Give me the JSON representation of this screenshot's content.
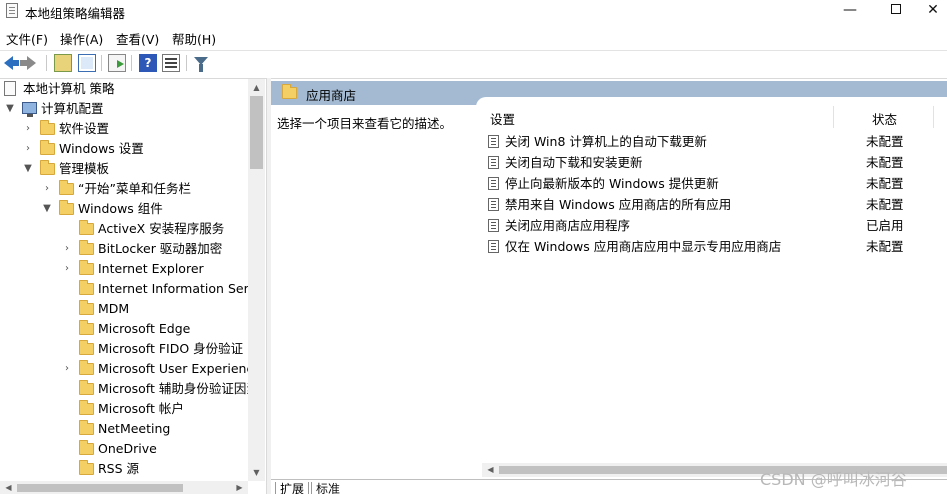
{
  "window": {
    "title": "本地组策略编辑器",
    "minimize": "—",
    "close": "✕"
  },
  "menu": [
    {
      "label": "文件(F)"
    },
    {
      "label": "操作(A)"
    },
    {
      "label": "查看(V)"
    },
    {
      "label": "帮助(H)"
    }
  ],
  "toolbar": {
    "icons": [
      "back-arrow-icon",
      "forward-arrow-icon",
      "up-folder-icon",
      "show-hide-tree-icon",
      "export-list-icon",
      "help-icon",
      "properties-icon",
      "filter-icon"
    ],
    "help_glyph": "?"
  },
  "tree": {
    "items": [
      {
        "label": "本地计算机 策略",
        "level": 0,
        "icon": "document-icon",
        "expander": ""
      },
      {
        "label": "计算机配置",
        "level": 1,
        "icon": "computer-icon",
        "expander": "▼"
      },
      {
        "label": "软件设置",
        "level": 2,
        "icon": "folder-icon",
        "expander": "›"
      },
      {
        "label": "Windows 设置",
        "level": 2,
        "icon": "folder-icon",
        "expander": "›"
      },
      {
        "label": "管理模板",
        "level": 2,
        "icon": "folder-icon",
        "expander": "▼"
      },
      {
        "label": "“开始”菜单和任务栏",
        "level": 3,
        "icon": "folder-icon",
        "expander": "›"
      },
      {
        "label": "Windows 组件",
        "level": 3,
        "icon": "folder-icon",
        "expander": "▼"
      },
      {
        "label": "ActiveX 安装程序服务",
        "level": 4,
        "icon": "folder-icon",
        "expander": ""
      },
      {
        "label": "BitLocker 驱动器加密",
        "level": 4,
        "icon": "folder-icon",
        "expander": "›"
      },
      {
        "label": "Internet Explorer",
        "level": 4,
        "icon": "folder-icon",
        "expander": "›"
      },
      {
        "label": "Internet Information Servi",
        "level": 4,
        "icon": "folder-icon",
        "expander": ""
      },
      {
        "label": "MDM",
        "level": 4,
        "icon": "folder-icon",
        "expander": ""
      },
      {
        "label": "Microsoft Edge",
        "level": 4,
        "icon": "folder-icon",
        "expander": ""
      },
      {
        "label": "Microsoft FIDO 身份验证",
        "level": 4,
        "icon": "folder-icon",
        "expander": ""
      },
      {
        "label": "Microsoft User Experience",
        "level": 4,
        "icon": "folder-icon",
        "expander": "›"
      },
      {
        "label": "Microsoft 辅助身份验证因素",
        "level": 4,
        "icon": "folder-icon",
        "expander": ""
      },
      {
        "label": "Microsoft 帐户",
        "level": 4,
        "icon": "folder-icon",
        "expander": ""
      },
      {
        "label": "NetMeeting",
        "level": 4,
        "icon": "folder-icon",
        "expander": ""
      },
      {
        "label": "OneDrive",
        "level": 4,
        "icon": "folder-icon",
        "expander": ""
      },
      {
        "label": "RSS 源",
        "level": 4,
        "icon": "folder-icon",
        "expander": ""
      }
    ]
  },
  "right": {
    "header_title": "应用商店",
    "description": "选择一个项目来查看它的描述。",
    "columns": {
      "setting": "设置",
      "state": "状态"
    },
    "rows": [
      {
        "name": "关闭 Win8 计算机上的自动下载更新",
        "state": "未配置"
      },
      {
        "name": "关闭自动下载和安装更新",
        "state": "未配置"
      },
      {
        "name": "停止向最新版本的 Windows 提供更新",
        "state": "未配置"
      },
      {
        "name": "禁用来自 Windows 应用商店的所有应用",
        "state": "未配置"
      },
      {
        "name": "关闭应用商店应用程序",
        "state": "已启用"
      },
      {
        "name": "仅在 Windows 应用商店应用中显示专用应用商店",
        "state": "未配置"
      }
    ],
    "tabs": [
      {
        "label": "扩展"
      },
      {
        "label": "标准"
      }
    ]
  },
  "watermark": "CSDN @呼叫冰河谷"
}
